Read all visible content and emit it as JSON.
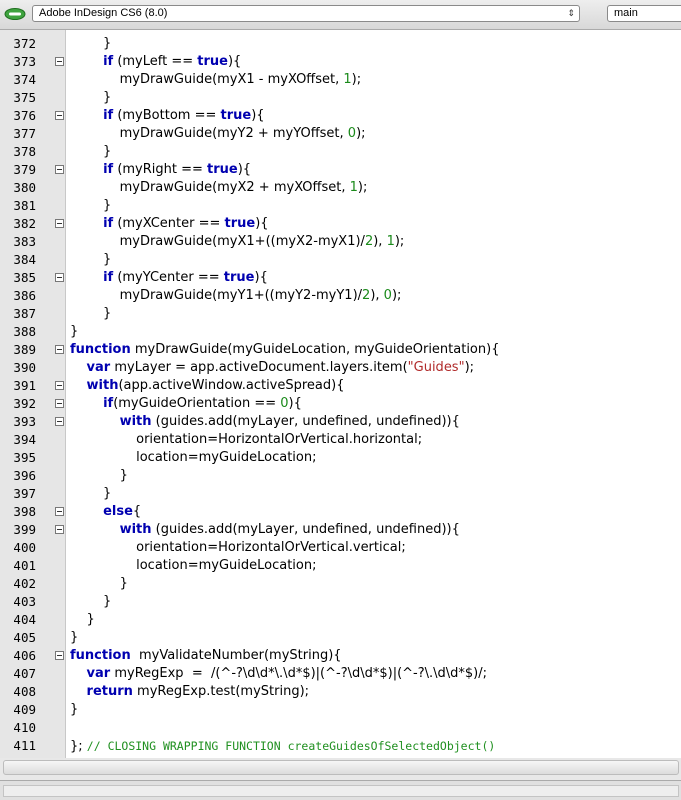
{
  "toolbar": {
    "target_app": "Adobe InDesign CS6 (8.0)",
    "function_menu": "main",
    "icons": [
      "link-icon",
      "chevron-updown-icon"
    ]
  },
  "colors": {
    "keyword": "#0000b0",
    "string": "#b02a2a",
    "number": "#1a8a1a",
    "comment": "#209020",
    "gutter": "#e6e6e6"
  },
  "editor": {
    "lines": [
      {
        "n": "372",
        "fold": false,
        "tokens": [
          {
            "t": "        }",
            "c": ""
          }
        ]
      },
      {
        "n": "373",
        "fold": true,
        "tokens": [
          {
            "t": "        ",
            "c": ""
          },
          {
            "t": "if",
            "c": "kw"
          },
          {
            "t": " (myLeft == ",
            "c": ""
          },
          {
            "t": "true",
            "c": "kw"
          },
          {
            "t": "){",
            "c": ""
          }
        ]
      },
      {
        "n": "374",
        "fold": false,
        "tokens": [
          {
            "t": "            myDrawGuide(myX1 - myXOffset, ",
            "c": ""
          },
          {
            "t": "1",
            "c": "num"
          },
          {
            "t": ");",
            "c": ""
          }
        ]
      },
      {
        "n": "375",
        "fold": false,
        "tokens": [
          {
            "t": "        }",
            "c": ""
          }
        ]
      },
      {
        "n": "376",
        "fold": true,
        "tokens": [
          {
            "t": "        ",
            "c": ""
          },
          {
            "t": "if",
            "c": "kw"
          },
          {
            "t": " (myBottom == ",
            "c": ""
          },
          {
            "t": "true",
            "c": "kw"
          },
          {
            "t": "){",
            "c": ""
          }
        ]
      },
      {
        "n": "377",
        "fold": false,
        "tokens": [
          {
            "t": "            myDrawGuide(myY2 + myYOffset, ",
            "c": ""
          },
          {
            "t": "0",
            "c": "num"
          },
          {
            "t": ");",
            "c": ""
          }
        ]
      },
      {
        "n": "378",
        "fold": false,
        "tokens": [
          {
            "t": "        }",
            "c": ""
          }
        ]
      },
      {
        "n": "379",
        "fold": true,
        "tokens": [
          {
            "t": "        ",
            "c": ""
          },
          {
            "t": "if",
            "c": "kw"
          },
          {
            "t": " (myRight == ",
            "c": ""
          },
          {
            "t": "true",
            "c": "kw"
          },
          {
            "t": "){",
            "c": ""
          }
        ]
      },
      {
        "n": "380",
        "fold": false,
        "tokens": [
          {
            "t": "            myDrawGuide(myX2 + myXOffset, ",
            "c": ""
          },
          {
            "t": "1",
            "c": "num"
          },
          {
            "t": ");",
            "c": ""
          }
        ]
      },
      {
        "n": "381",
        "fold": false,
        "tokens": [
          {
            "t": "        }",
            "c": ""
          }
        ]
      },
      {
        "n": "382",
        "fold": true,
        "tokens": [
          {
            "t": "        ",
            "c": ""
          },
          {
            "t": "if",
            "c": "kw"
          },
          {
            "t": " (myXCenter == ",
            "c": ""
          },
          {
            "t": "true",
            "c": "kw"
          },
          {
            "t": "){",
            "c": ""
          }
        ]
      },
      {
        "n": "383",
        "fold": false,
        "tokens": [
          {
            "t": "            myDrawGuide(myX1+((myX2-myX1)/",
            "c": ""
          },
          {
            "t": "2",
            "c": "num"
          },
          {
            "t": "), ",
            "c": ""
          },
          {
            "t": "1",
            "c": "num"
          },
          {
            "t": ");",
            "c": ""
          }
        ]
      },
      {
        "n": "384",
        "fold": false,
        "tokens": [
          {
            "t": "        }",
            "c": ""
          }
        ]
      },
      {
        "n": "385",
        "fold": true,
        "tokens": [
          {
            "t": "        ",
            "c": ""
          },
          {
            "t": "if",
            "c": "kw"
          },
          {
            "t": " (myYCenter == ",
            "c": ""
          },
          {
            "t": "true",
            "c": "kw"
          },
          {
            "t": "){",
            "c": ""
          }
        ]
      },
      {
        "n": "386",
        "fold": false,
        "tokens": [
          {
            "t": "            myDrawGuide(myY1+((myY2-myY1)/",
            "c": ""
          },
          {
            "t": "2",
            "c": "num"
          },
          {
            "t": "), ",
            "c": ""
          },
          {
            "t": "0",
            "c": "num"
          },
          {
            "t": ");",
            "c": ""
          }
        ]
      },
      {
        "n": "387",
        "fold": false,
        "tokens": [
          {
            "t": "        }",
            "c": ""
          }
        ]
      },
      {
        "n": "388",
        "fold": false,
        "tokens": [
          {
            "t": "}",
            "c": ""
          }
        ]
      },
      {
        "n": "389",
        "fold": true,
        "tokens": [
          {
            "t": "function",
            "c": "kw"
          },
          {
            "t": " myDrawGuide(myGuideLocation, myGuideOrientation){",
            "c": ""
          }
        ]
      },
      {
        "n": "390",
        "fold": false,
        "tokens": [
          {
            "t": "    ",
            "c": ""
          },
          {
            "t": "var",
            "c": "kw"
          },
          {
            "t": " myLayer = app.activeDocument.layers.item(",
            "c": ""
          },
          {
            "t": "\"Guides\"",
            "c": "str"
          },
          {
            "t": ");",
            "c": ""
          }
        ]
      },
      {
        "n": "391",
        "fold": true,
        "tokens": [
          {
            "t": "    ",
            "c": ""
          },
          {
            "t": "with",
            "c": "kw"
          },
          {
            "t": "(app.activeWindow.activeSpread){",
            "c": ""
          }
        ]
      },
      {
        "n": "392",
        "fold": true,
        "tokens": [
          {
            "t": "        ",
            "c": ""
          },
          {
            "t": "if",
            "c": "kw"
          },
          {
            "t": "(myGuideOrientation == ",
            "c": ""
          },
          {
            "t": "0",
            "c": "num"
          },
          {
            "t": "){",
            "c": ""
          }
        ]
      },
      {
        "n": "393",
        "fold": true,
        "tokens": [
          {
            "t": "            ",
            "c": ""
          },
          {
            "t": "with",
            "c": "kw"
          },
          {
            "t": " (guides.add(myLayer, undefined, undefined)){",
            "c": ""
          }
        ]
      },
      {
        "n": "394",
        "fold": false,
        "tokens": [
          {
            "t": "                orientation=HorizontalOrVertical.horizontal;",
            "c": ""
          }
        ]
      },
      {
        "n": "395",
        "fold": false,
        "tokens": [
          {
            "t": "                location=myGuideLocation;",
            "c": ""
          }
        ]
      },
      {
        "n": "396",
        "fold": false,
        "tokens": [
          {
            "t": "            }",
            "c": ""
          }
        ]
      },
      {
        "n": "397",
        "fold": false,
        "tokens": [
          {
            "t": "        }",
            "c": ""
          }
        ]
      },
      {
        "n": "398",
        "fold": true,
        "tokens": [
          {
            "t": "        ",
            "c": ""
          },
          {
            "t": "else",
            "c": "kw"
          },
          {
            "t": "{",
            "c": ""
          }
        ]
      },
      {
        "n": "399",
        "fold": true,
        "tokens": [
          {
            "t": "            ",
            "c": ""
          },
          {
            "t": "with",
            "c": "kw"
          },
          {
            "t": " (guides.add(myLayer, undefined, undefined)){",
            "c": ""
          }
        ]
      },
      {
        "n": "400",
        "fold": false,
        "tokens": [
          {
            "t": "                orientation=HorizontalOrVertical.vertical;",
            "c": ""
          }
        ]
      },
      {
        "n": "401",
        "fold": false,
        "tokens": [
          {
            "t": "                location=myGuideLocation;",
            "c": ""
          }
        ]
      },
      {
        "n": "402",
        "fold": false,
        "tokens": [
          {
            "t": "            }",
            "c": ""
          }
        ]
      },
      {
        "n": "403",
        "fold": false,
        "tokens": [
          {
            "t": "        }",
            "c": ""
          }
        ]
      },
      {
        "n": "404",
        "fold": false,
        "tokens": [
          {
            "t": "    }",
            "c": ""
          }
        ]
      },
      {
        "n": "405",
        "fold": false,
        "tokens": [
          {
            "t": "}",
            "c": ""
          }
        ]
      },
      {
        "n": "406",
        "fold": true,
        "tokens": [
          {
            "t": "function",
            "c": "kw"
          },
          {
            "t": "  myValidateNumber(myString){",
            "c": ""
          }
        ]
      },
      {
        "n": "407",
        "fold": false,
        "tokens": [
          {
            "t": "    ",
            "c": ""
          },
          {
            "t": "var",
            "c": "kw"
          },
          {
            "t": " myRegExp  =  /(^-?\\d\\d*\\.\\d*$)|(^-?\\d\\d*$)|(^-?\\.\\d\\d*$)/;",
            "c": ""
          }
        ]
      },
      {
        "n": "408",
        "fold": false,
        "tokens": [
          {
            "t": "    ",
            "c": ""
          },
          {
            "t": "return",
            "c": "kw"
          },
          {
            "t": " myRegExp.test(myString);",
            "c": ""
          }
        ]
      },
      {
        "n": "409",
        "fold": false,
        "tokens": [
          {
            "t": "}",
            "c": ""
          }
        ]
      },
      {
        "n": "410",
        "fold": false,
        "tokens": [
          {
            "t": "",
            "c": ""
          }
        ]
      },
      {
        "n": "411",
        "fold": false,
        "tokens": [
          {
            "t": "}; ",
            "c": ""
          },
          {
            "t": "// CLOSING WRAPPING FUNCTION createGuidesOfSelectedObject()",
            "c": "cmt"
          }
        ]
      }
    ]
  }
}
